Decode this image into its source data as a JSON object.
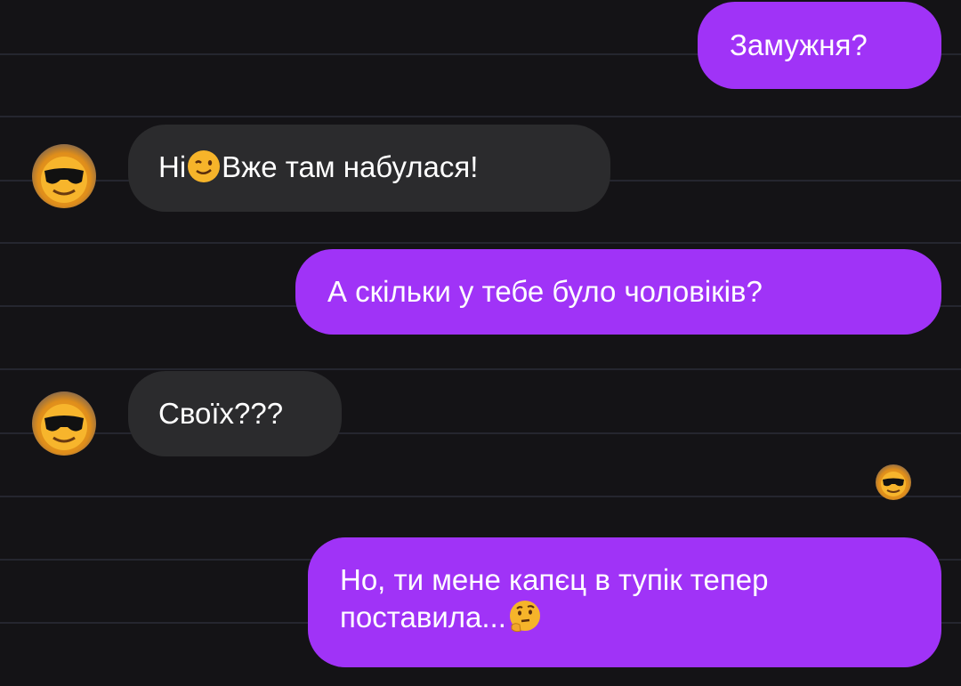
{
  "chat": {
    "messages": [
      {
        "direction": "outgoing",
        "text": "Замужня?"
      },
      {
        "direction": "incoming",
        "text_before_emoji": "Ні",
        "emoji": "winking-face-icon",
        "text_after_emoji": "Вже там набулася!"
      },
      {
        "direction": "outgoing",
        "text": "А скільки у тебе було чоловіків?"
      },
      {
        "direction": "incoming",
        "text": "Своїх???"
      },
      {
        "direction": "outgoing",
        "line1": "Но, ти мене капєц в тупік тепер",
        "line2": "поставила...",
        "emoji": "thinking-face-icon"
      }
    ],
    "read_receipt": "smiling-face-with-sunglasses-avatar",
    "colors": {
      "background": "#141316",
      "outgoing_bubble": "#a033f7",
      "incoming_bubble": "#2b2b2d",
      "text": "#ffffff"
    }
  }
}
